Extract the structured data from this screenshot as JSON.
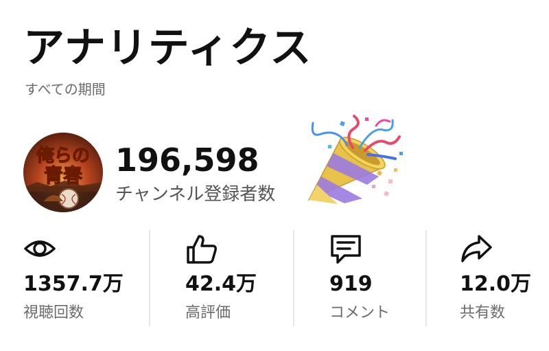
{
  "header": {
    "title": "アナリティクス",
    "period": "すべての期間"
  },
  "channel": {
    "avatar_text": "俺らの青春",
    "subscriber_count": "196,598",
    "subscriber_label": "チャンネル登録者数",
    "celebration_icon": "party-popper"
  },
  "stats": [
    {
      "icon": "eye-icon",
      "value": "1357.7万",
      "label": "視聴回数"
    },
    {
      "icon": "thumbs-up-icon",
      "value": "42.4万",
      "label": "高評価"
    },
    {
      "icon": "comment-icon",
      "value": "919",
      "label": "コメント"
    },
    {
      "icon": "share-icon",
      "value": "12.0万",
      "label": "共有数"
    }
  ],
  "colors": {
    "text": "#111111",
    "secondary_text": "#6b6b6b",
    "divider": "#e6e6e6"
  }
}
